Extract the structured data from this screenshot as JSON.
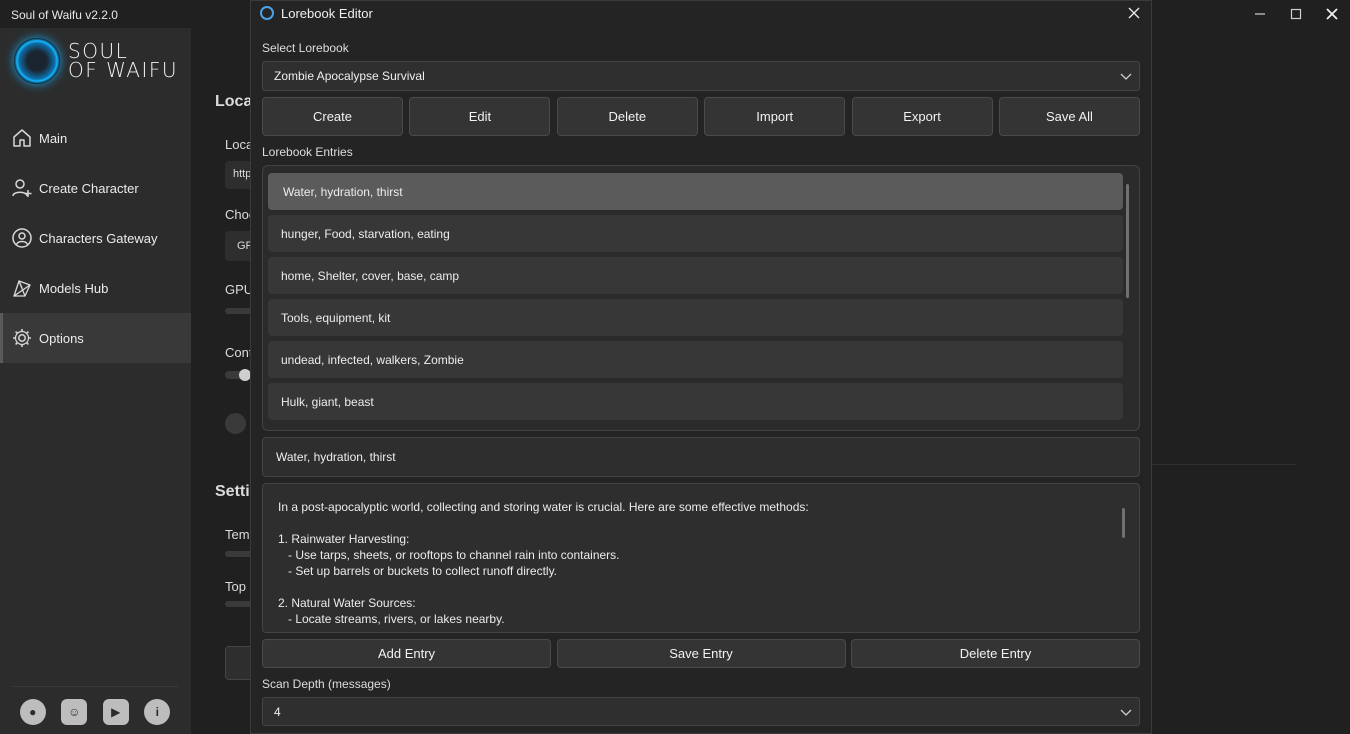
{
  "app": {
    "title": "Soul of Waifu v2.2.0",
    "logo_line1": "SOUL",
    "logo_line2": "OF WAIFU"
  },
  "sidebar": {
    "items": [
      {
        "label": "Main",
        "icon": "home-icon"
      },
      {
        "label": "Create Character",
        "icon": "add-user-icon"
      },
      {
        "label": "Characters Gateway",
        "icon": "user-circle-icon"
      },
      {
        "label": "Models Hub",
        "icon": "network-icon"
      },
      {
        "label": "Options",
        "icon": "gear-icon",
        "active": true
      }
    ]
  },
  "background": {
    "frag_local": "Loca",
    "frag_local2": "Loca",
    "frag_http": "http",
    "frag_choo": "Choo",
    "frag_gp": "GP",
    "frag_gpu": "GPU",
    "frag_cont": "Cont",
    "frag_setti": "Setti",
    "frag_temp": "Temp",
    "frag_top": "Top"
  },
  "dialog": {
    "title": "Lorebook Editor",
    "select_label": "Select Lorebook",
    "selected_lorebook": "Zombie Apocalypse Survival",
    "buttons": [
      "Create",
      "Edit",
      "Delete",
      "Import",
      "Export",
      "Save All"
    ],
    "entries_label": "Lorebook Entries",
    "entries": [
      "Water, hydration, thirst",
      "hunger, Food, starvation, eating",
      "home, Shelter, cover, base, camp",
      "Tools, equipment, kit",
      "undead, infected, walkers, Zombie",
      "Hulk, giant, beast"
    ],
    "selected_entry_index": 0,
    "entry_keys": "Water, hydration, thirst",
    "entry_content": [
      "In a post-apocalyptic world, collecting and storing water is crucial. Here are some effective methods:",
      "",
      "1. Rainwater Harvesting:",
      "   - Use tarps, sheets, or rooftops to channel rain into containers.",
      "   - Set up barrels or buckets to collect runoff directly.",
      "",
      "2. Natural Water Sources:",
      "   - Locate streams, rivers, or lakes nearby."
    ],
    "entry_buttons": [
      "Add Entry",
      "Save Entry",
      "Delete Entry"
    ],
    "scan_depth_label": "Scan Depth (messages)",
    "scan_depth_value": "4"
  }
}
